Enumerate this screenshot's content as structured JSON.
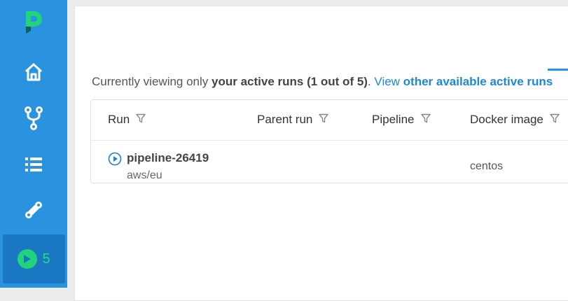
{
  "sidebar": {
    "items": [
      {
        "name": "home",
        "icon": "home-icon"
      },
      {
        "name": "pipelines",
        "icon": "fork-icon"
      },
      {
        "name": "library",
        "icon": "list-icon"
      },
      {
        "name": "tools",
        "icon": "tools-icon"
      }
    ],
    "active_runs": {
      "icon": "play-circle-icon",
      "count": "5"
    },
    "colors": {
      "background": "#2a93df",
      "active": "#1a78c2",
      "accent": "#21d37a"
    }
  },
  "info": {
    "prefix": "Currently viewing only ",
    "bold": "your active runs (1 out of 5)",
    "suffix": ". ",
    "view": "View ",
    "link": "other available active runs"
  },
  "table": {
    "columns": [
      "Run",
      "Parent run",
      "Pipeline",
      "Docker image"
    ],
    "rows": [
      {
        "run": "pipeline-26419",
        "sub": "aws/eu",
        "parent": "",
        "pipeline": "",
        "docker": "centos"
      }
    ]
  }
}
